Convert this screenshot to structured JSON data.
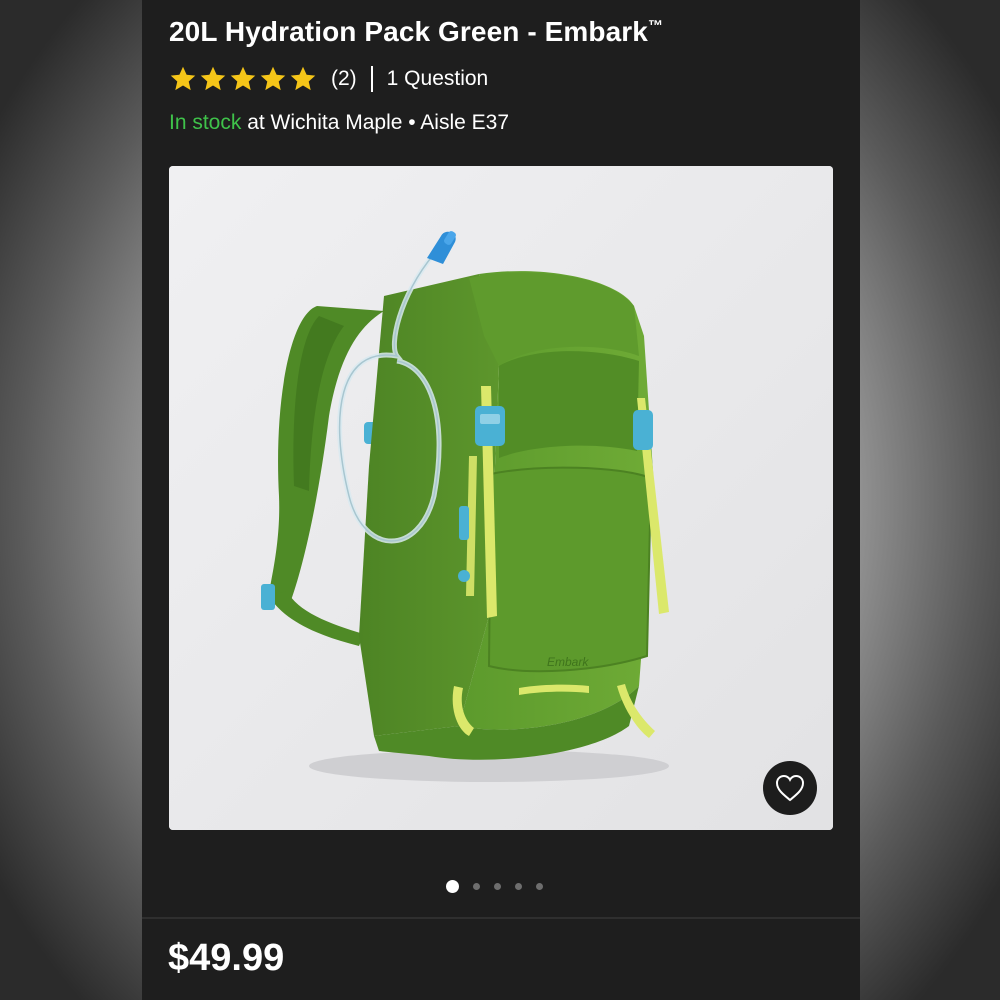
{
  "product": {
    "title": "20L Hydration Pack Green - Embark",
    "trademark": "™",
    "rating_stars": 5,
    "review_count": "(2)",
    "questions": "1 Question",
    "stock_status": "In stock",
    "store_location": " at Wichita Maple • Aisle E37",
    "price": "$49.99",
    "brand_on_bag": "Embark"
  },
  "gallery": {
    "image_count": 5,
    "active_index": 0,
    "favorite_icon": "heart-outline-icon"
  },
  "colors": {
    "panel": "#1e1e1e",
    "in_stock": "#3fc24a",
    "star": "#f5c518",
    "pack_green": "#5f9a2f",
    "accent_yellow": "#dbe86b",
    "accent_blue": "#4ab1d4"
  }
}
